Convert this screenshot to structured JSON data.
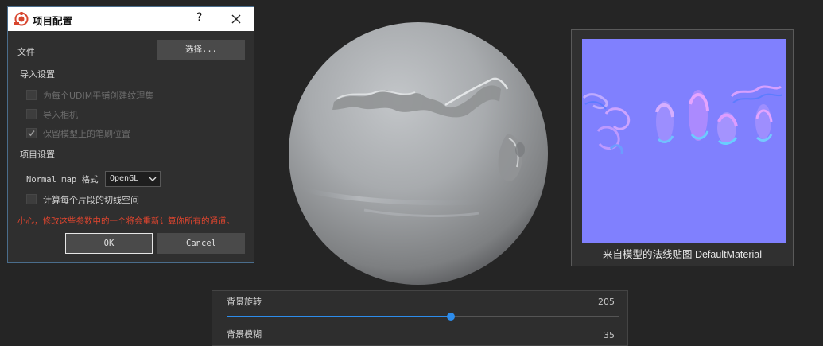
{
  "dialog": {
    "title": "项目配置",
    "help_label": "?",
    "file_label": "文件",
    "select_button": "选择...",
    "import_section": "导入设置",
    "import_options": [
      {
        "label": "为每个UDIM平铺创建纹理集",
        "checked": false,
        "enabled": false
      },
      {
        "label": "导入相机",
        "checked": false,
        "enabled": false
      },
      {
        "label": "保留模型上的笔刷位置",
        "checked": true,
        "enabled": false
      }
    ],
    "project_section": "项目设置",
    "normal_map_label": "Normal map 格式",
    "normal_map_value": "OpenGL",
    "tangent_label": "计算每个片段的切线空间",
    "tangent_checked": false,
    "warning": "小心，修改这些参数中的一个将会重新计算你所有的通道。",
    "ok_label": "OK",
    "cancel_label": "Cancel",
    "colors": {
      "warning": "#e0452f",
      "accent": "#2d8ceb",
      "border": "#4a6d8c"
    }
  },
  "preview": {
    "caption": "来自模型的法线贴图 DefaultMaterial"
  },
  "properties": {
    "rotation_label": "背景旋转",
    "rotation_value": "205",
    "rotation_fraction": 0.57,
    "blur_label": "背景模糊",
    "blur_value": "35"
  }
}
